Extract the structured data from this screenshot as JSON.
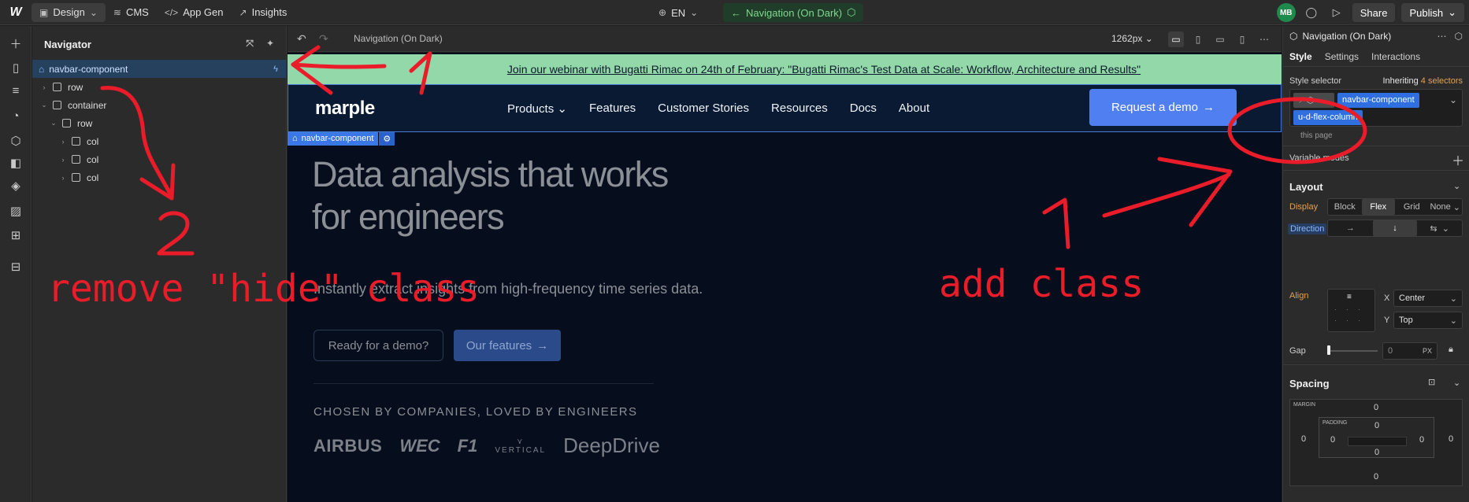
{
  "topbar": {
    "design_label": "Design",
    "cms_label": "CMS",
    "appgen_label": "App Gen",
    "insights_label": "Insights",
    "lang_label": "EN",
    "page_label": "Navigation (On Dark)",
    "avatar_initials": "MB",
    "share_label": "Share",
    "publish_label": "Publish"
  },
  "navigator": {
    "title": "Navigator",
    "tree": [
      {
        "label": "navbar-component"
      },
      {
        "label": "row"
      },
      {
        "label": "container"
      },
      {
        "label": "row"
      },
      {
        "label": "col"
      },
      {
        "label": "col"
      },
      {
        "label": "col"
      }
    ]
  },
  "canvas": {
    "title": "Navigation (On Dark)",
    "breakpoint": "1262px"
  },
  "site": {
    "banner": "Join our webinar with Bugatti Rimac on 24th of February: \"Bugatti Rimac's Test Data at Scale: Workflow, Architecture and Results\"",
    "brand": "marple",
    "menu": [
      "Products",
      "Features",
      "Customer Stories",
      "Resources",
      "Docs",
      "About"
    ],
    "demo_button": "Request a demo",
    "component_tag": "navbar-component",
    "hero_title": "Data analysis that works for engineers",
    "hero_sub": "Instantly extract insights from high-frequency time series data.",
    "ghost_button": "Ready for a demo?",
    "features_button": "Our features",
    "chosen": "CHOSEN BY COMPANIES, LOVED BY ENGINEERS",
    "logos": [
      "AIRBUS",
      "WEC",
      "F1",
      "VERTICAL",
      "DeepDrive"
    ]
  },
  "panel": {
    "element_name": "Navigation (On Dark)",
    "tabs": [
      "Style",
      "Settings",
      "Interactions"
    ],
    "style_selector_label": "Style selector",
    "inheriting_prefix": "Inheriting",
    "inheriting_count": "4 selectors",
    "chip_primary": "navbar-component",
    "chip_secondary": "u-d-flex-column",
    "on_this_page": "this page",
    "variable_modes": "Variable modes",
    "layout": {
      "title": "Layout",
      "display_label": "Display",
      "display_options": [
        "Block",
        "Flex",
        "Grid",
        "None"
      ],
      "direction_label": "Direction",
      "align_label": "Align",
      "x_label": "X",
      "x_value": "Center",
      "y_label": "Y",
      "y_value": "Top",
      "gap_label": "Gap",
      "gap_value": "0",
      "gap_unit": "PX"
    },
    "spacing": {
      "title": "Spacing",
      "margin_label": "MARGIN",
      "padding_label": "PADDING",
      "margin_top": "0",
      "margin_left": "0",
      "margin_right": "0",
      "margin_bottom": "0",
      "padding_top": "0",
      "padding_left": "0",
      "padding_right": "0",
      "padding_bottom": "0"
    }
  },
  "annotations": {
    "num1_left": "1",
    "num2": "2",
    "remove_text": "remove \"hide\" class",
    "num1_right": "1",
    "add_text": "add class"
  },
  "colors": {
    "accent": "#4f7ff0",
    "annotation": "#ea1c2a",
    "banner": "#93d8a8",
    "page_chip": "#7fd88f"
  }
}
